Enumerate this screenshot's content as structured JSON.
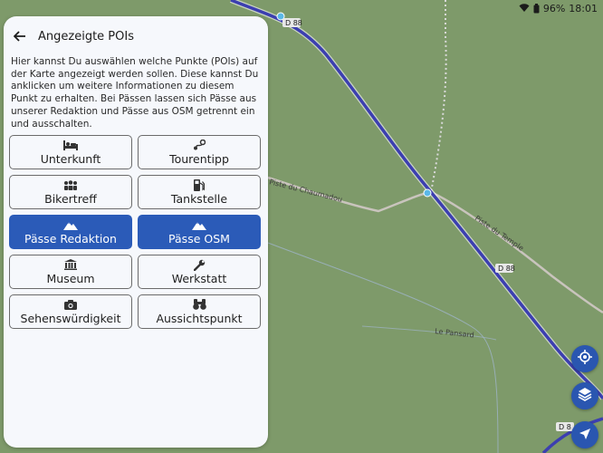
{
  "status": {
    "battery": "96%",
    "time": "18:01",
    "wifi_icon": "wifi-icon",
    "battery_icon": "battery-icon"
  },
  "map": {
    "labels": {
      "piste_chaumadou": "Piste du Chaumadou",
      "piste_temple": "Piste du Temple",
      "le_pansard": "Le Pansard",
      "d88_top": "D 88",
      "d88_mid": "D 88",
      "d88_bottom": "D 8"
    },
    "colors": {
      "background": "#7e9a6a",
      "route": "#3c3fb0",
      "road": "#c9c4bd"
    }
  },
  "panel": {
    "title": "Angezeigte POIs",
    "back_icon": "arrow-left-icon",
    "description": "Hier kannst Du auswählen welche Punkte (POIs) auf der Karte angezeigt werden sollen. Diese kannst Du anklicken um weitere Informationen zu diesem Punkt zu erhalten. Bei Pässen lassen sich Pässe aus unserer Redaktion und Pässe aus OSM getrennt ein und ausschalten.",
    "buttons": [
      {
        "label": "Unterkunft",
        "icon": "bed-icon",
        "active": false
      },
      {
        "label": "Tourentipp",
        "icon": "route-icon",
        "active": false
      },
      {
        "label": "Bikertreff",
        "icon": "group-icon",
        "active": false
      },
      {
        "label": "Tankstelle",
        "icon": "fuel-icon",
        "active": false
      },
      {
        "label": "Pässe Redaktion",
        "icon": "mountain-icon",
        "active": true
      },
      {
        "label": "Pässe OSM",
        "icon": "mountain-icon",
        "active": true
      },
      {
        "label": "Museum",
        "icon": "museum-icon",
        "active": false
      },
      {
        "label": "Werkstatt",
        "icon": "wrench-icon",
        "active": false
      },
      {
        "label": "Sehenswürdigkeit",
        "icon": "camera-icon",
        "active": false
      },
      {
        "label": "Aussichtspunkt",
        "icon": "binoculars-icon",
        "active": false
      }
    ],
    "active_color": "#2b5bb8"
  },
  "fabs": {
    "locate_icon": "gps-locate-icon",
    "layers_icon": "layers-icon",
    "navigate_icon": "navigation-arrow-icon"
  }
}
